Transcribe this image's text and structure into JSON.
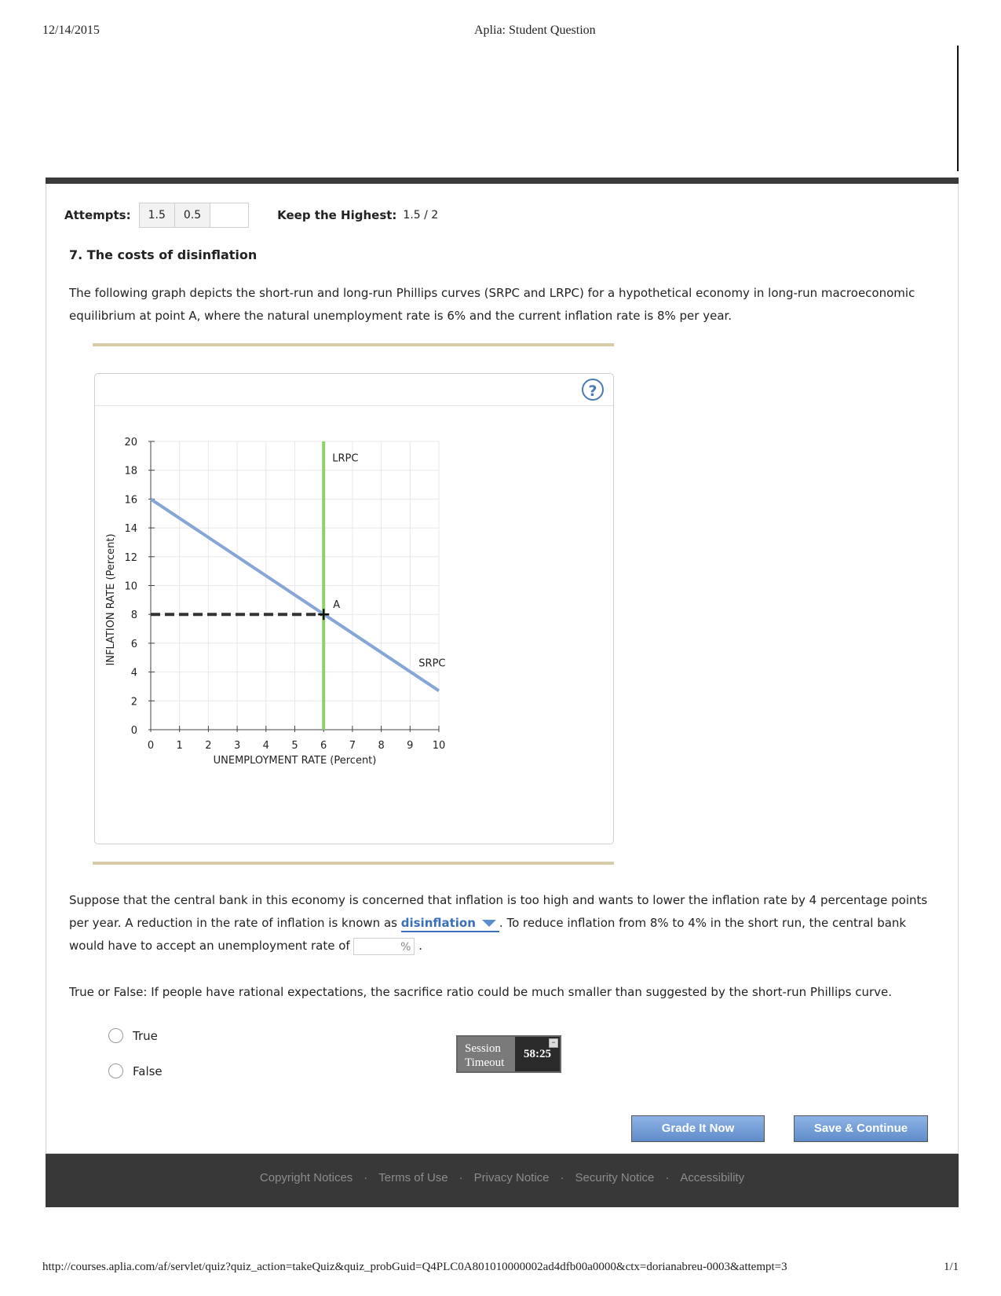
{
  "print_header": {
    "date": "12/14/2015",
    "title": "Aplia: Student Question"
  },
  "attempts": {
    "label": "Attempts:",
    "scores": [
      "1.5",
      "0.5",
      ""
    ],
    "keep_label": "Keep the Highest:",
    "keep_value": "1.5 / 2"
  },
  "question": {
    "title": "7. The costs of disinflation",
    "intro": "The following graph depicts the short-run and long-run Phillips curves (SRPC and LRPC) for a hypothetical economy in long-run macroeconomic equilibrium at point A, where the natural unemployment rate is 6% and the current inflation rate is 8% per year.",
    "part2_a": "Suppose that the central bank in this economy is concerned that inflation is too high and wants to lower the inflation rate by 4 percentage points per year. A reduction in the rate of inflation is known as",
    "dropdown_value": "disinflation",
    "part2_b": ". To reduce inflation from 8% to 4% in the short run, the central bank would have to accept an unemployment rate of",
    "input_unit": "%",
    "part2_end": ".",
    "tf_question": "True or False: If people have rational expectations, the sacrifice ratio could be much smaller than suggested by the short-run Phillips curve.",
    "options": [
      "True",
      "False"
    ]
  },
  "graph": {
    "help_icon": "question-mark-icon",
    "help_glyph": "?"
  },
  "chart_data": {
    "type": "line",
    "xlabel": "UNEMPLOYMENT RATE (Percent)",
    "ylabel": "INFLATION RATE (Percent)",
    "xlim": [
      0,
      10
    ],
    "ylim": [
      0,
      20
    ],
    "xticks": [
      0,
      1,
      2,
      3,
      4,
      5,
      6,
      7,
      8,
      9,
      10
    ],
    "yticks": [
      0,
      2,
      4,
      6,
      8,
      10,
      12,
      14,
      16,
      18,
      20
    ],
    "grid": true,
    "series": [
      {
        "name": "SRPC",
        "color": "#86a6d6",
        "points": [
          [
            0,
            16
          ],
          [
            10,
            2.7
          ]
        ]
      },
      {
        "name": "LRPC",
        "color": "#8dd16a",
        "points": [
          [
            6,
            0
          ],
          [
            6,
            20
          ]
        ]
      }
    ],
    "guide": {
      "from": [
        0,
        8
      ],
      "to": [
        6,
        8
      ],
      "style": "dashed",
      "color": "#333333"
    },
    "point": {
      "label": "A",
      "x": 6,
      "y": 8
    }
  },
  "session": {
    "label_line1": "Session",
    "label_line2": "Timeout",
    "time": "58:25",
    "minimize": "−"
  },
  "buttons": {
    "grade": "Grade It Now",
    "save": "Save & Continue"
  },
  "footer": {
    "links": [
      "Copyright Notices",
      "Terms of Use",
      "Privacy Notice",
      "Security Notice",
      "Accessibility"
    ],
    "separator": "·"
  },
  "print_footer": {
    "url": "http://courses.aplia.com/af/servlet/quiz?quiz_action=takeQuiz&quiz_probGuid=Q4PLC0A801010000002ad4dfb00a0000&ctx=dorianabreu-0003&attempt=3",
    "page": "1/1"
  }
}
